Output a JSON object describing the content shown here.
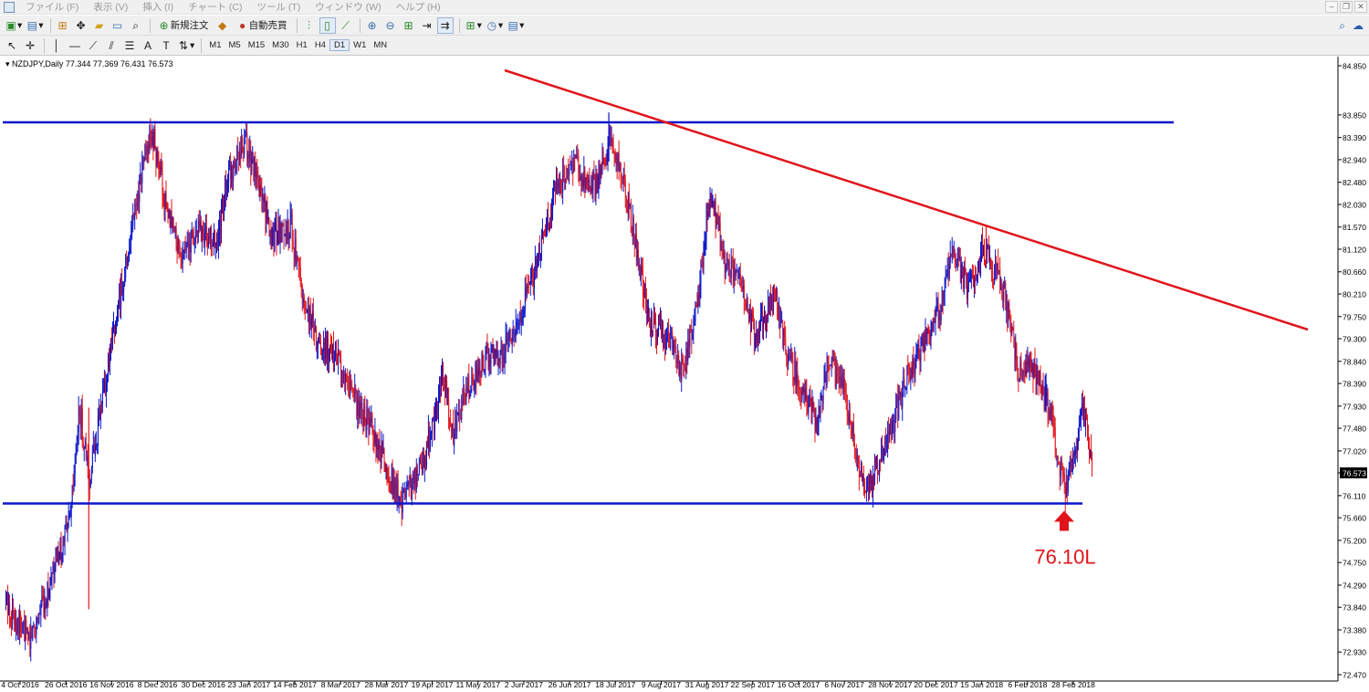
{
  "menu": {
    "items": [
      "ファイル (F)",
      "表示 (V)",
      "挿入 (I)",
      "チャート (C)",
      "ツール (T)",
      "ウィンドウ (W)",
      "ヘルプ (H)"
    ]
  },
  "toolbar": {
    "new_order": "新規注文",
    "auto_trade": "自動売買"
  },
  "timeframes": [
    "M1",
    "M5",
    "M15",
    "M30",
    "H1",
    "H4",
    "D1",
    "W1",
    "MN"
  ],
  "active_timeframe": "D1",
  "chart": {
    "symbol_line": "NZDJPY,Daily  77.344 77.369 76.431 76.573",
    "current_price_label": "76.573",
    "annotation": "76.10L"
  },
  "colors": {
    "bull_candle": "#0b17c9",
    "bear_candle": "#e0151b",
    "support_resistance": "#0b17c9",
    "trendline": "#e0151b",
    "annotation": "#e0151b"
  },
  "chart_data": {
    "type": "candlestick",
    "y_ticks": [
      "84.850",
      "83.850",
      "83.390",
      "82.940",
      "82.480",
      "82.030",
      "81.570",
      "81.120",
      "80.660",
      "80.210",
      "79.750",
      "79.300",
      "78.840",
      "78.390",
      "77.930",
      "77.480",
      "77.020",
      "76.573",
      "76.110",
      "75.660",
      "75.200",
      "74.750",
      "74.290",
      "73.840",
      "73.380",
      "72.930",
      "72.470"
    ],
    "ylim": [
      72.47,
      84.85
    ],
    "x_ticks": [
      "4 Oct 2016",
      "26 Oct 2016",
      "16 Nov 2016",
      "8 Dec 2016",
      "30 Dec 2016",
      "23 Jan 2017",
      "14 Feb 2017",
      "8 Mar 2017",
      "28 Mar 2017",
      "19 Apr 2017",
      "11 May 2017",
      "2 Jun 2017",
      "26 Jun 2017",
      "18 Jul 2017",
      "9 Aug 2017",
      "31 Aug 2017",
      "22 Sep 2017",
      "16 Oct 2017",
      "6 Nov 2017",
      "28 Nov 2017",
      "20 Dec 2017",
      "15 Jan 2018",
      "6 Feb 2018",
      "28 Feb 2018"
    ],
    "path_points": [
      [
        0,
        73.9
      ],
      [
        5,
        73.2
      ],
      [
        10,
        74.4
      ],
      [
        14,
        75.6
      ],
      [
        16,
        77.9
      ],
      [
        18,
        76.4
      ],
      [
        22,
        78.6
      ],
      [
        26,
        80.8
      ],
      [
        30,
        83.0
      ],
      [
        32,
        83.4
      ],
      [
        35,
        81.8
      ],
      [
        38,
        81.0
      ],
      [
        42,
        81.5
      ],
      [
        46,
        81.2
      ],
      [
        48,
        82.6
      ],
      [
        52,
        83.3
      ],
      [
        55,
        82.3
      ],
      [
        58,
        81.4
      ],
      [
        62,
        81.6
      ],
      [
        64,
        80.3
      ],
      [
        68,
        79.2
      ],
      [
        72,
        79.0
      ],
      [
        76,
        78.0
      ],
      [
        80,
        77.4
      ],
      [
        84,
        76.3
      ],
      [
        86,
        76.0
      ],
      [
        90,
        76.6
      ],
      [
        93,
        77.6
      ],
      [
        95,
        78.6
      ],
      [
        97,
        77.3
      ],
      [
        100,
        78.2
      ],
      [
        104,
        78.9
      ],
      [
        108,
        79.0
      ],
      [
        112,
        79.9
      ],
      [
        116,
        81.0
      ],
      [
        120,
        82.5
      ],
      [
        124,
        82.8
      ],
      [
        128,
        82.3
      ],
      [
        131,
        83.3
      ],
      [
        133,
        83.0
      ],
      [
        136,
        81.6
      ],
      [
        140,
        79.6
      ],
      [
        144,
        79.3
      ],
      [
        147,
        78.6
      ],
      [
        150,
        79.8
      ],
      [
        153,
        82.3
      ],
      [
        156,
        80.9
      ],
      [
        159,
        80.6
      ],
      [
        163,
        79.3
      ],
      [
        167,
        80.2
      ],
      [
        170,
        78.9
      ],
      [
        174,
        78.1
      ],
      [
        176,
        77.6
      ],
      [
        179,
        78.8
      ],
      [
        182,
        78.3
      ],
      [
        186,
        76.4
      ],
      [
        188,
        76.4
      ],
      [
        192,
        77.4
      ],
      [
        196,
        78.6
      ],
      [
        200,
        79.3
      ],
      [
        203,
        79.9
      ],
      [
        206,
        81.1
      ],
      [
        209,
        80.3
      ],
      [
        212,
        81.0
      ],
      [
        214,
        80.9
      ],
      [
        217,
        80.2
      ],
      [
        220,
        78.6
      ],
      [
        223,
        78.7
      ],
      [
        227,
        77.8
      ],
      [
        230,
        76.2
      ],
      [
        232,
        76.8
      ],
      [
        234,
        77.9
      ],
      [
        236,
        76.7
      ]
    ],
    "lines": {
      "resistance": 83.7,
      "support": 75.95,
      "trendline": "declining, touching the Jul 2017, Sep 2017 and Jan 2018 highs"
    }
  }
}
